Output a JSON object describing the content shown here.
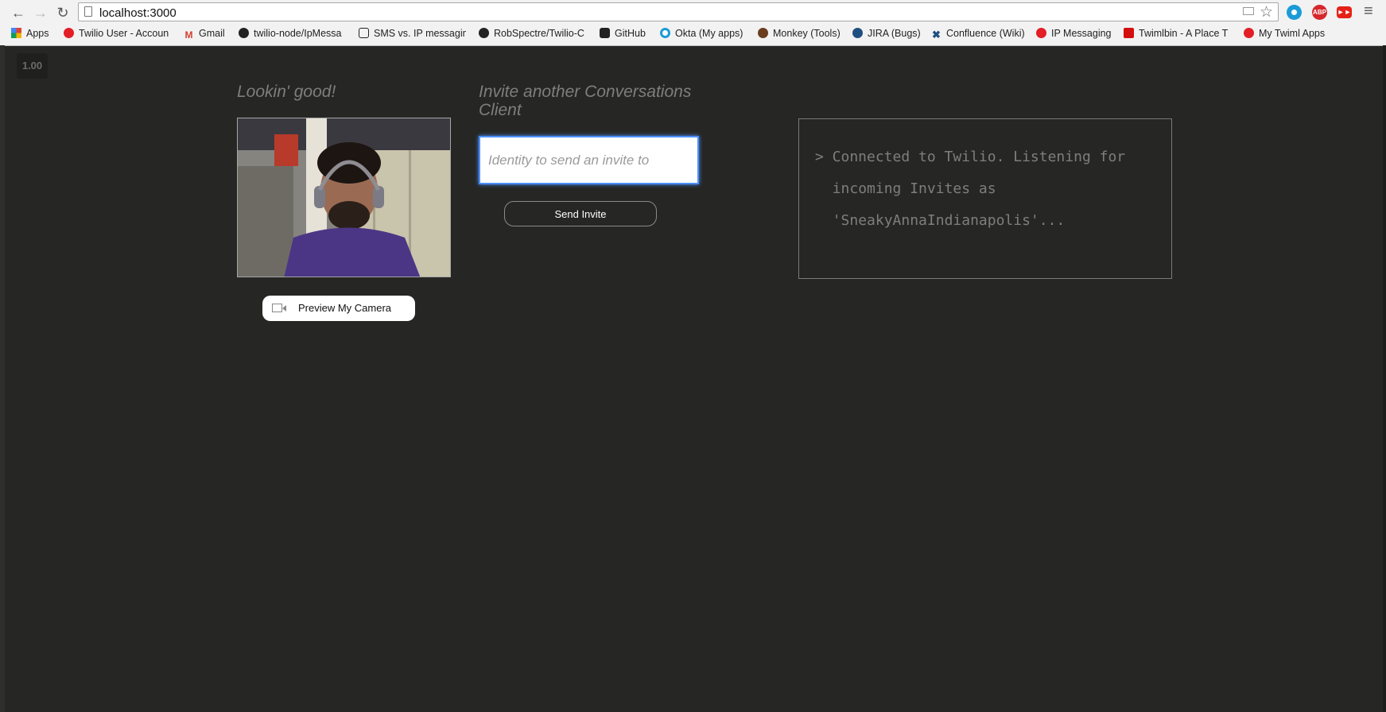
{
  "browser": {
    "url": "localhost:3000",
    "extensions": [
      "ABP"
    ],
    "bookmarks": [
      {
        "label": "Apps",
        "icon": "apps-grid-icon"
      },
      {
        "label": "Twilio User - Accoun",
        "icon": "twilio-icon"
      },
      {
        "label": "Gmail",
        "icon": "gmail-icon"
      },
      {
        "label": "twilio-node/IpMessa",
        "icon": "github-icon"
      },
      {
        "label": "SMS vs. IP messagin",
        "icon": "page-icon"
      },
      {
        "label": "RobSpectre/Twilio-C",
        "icon": "github-icon"
      },
      {
        "label": "GitHub",
        "icon": "github-icon"
      },
      {
        "label": "Okta (My apps)",
        "icon": "okta-icon"
      },
      {
        "label": "Monkey (Tools)",
        "icon": "monkey-icon"
      },
      {
        "label": "JIRA (Bugs)",
        "icon": "jira-icon"
      },
      {
        "label": "Confluence (Wiki)",
        "icon": "confluence-icon"
      },
      {
        "label": "IP Messaging",
        "icon": "twilio-icon"
      },
      {
        "label": "Twimlbin - A Place T",
        "icon": "twimlbin-icon"
      },
      {
        "label": "My Twiml Apps",
        "icon": "twilio-icon"
      }
    ]
  },
  "page": {
    "zoom_badge": "1.00",
    "local_heading": "Lookin' good!",
    "preview_button": "Preview My Camera",
    "invite_heading": "Invite another Conversations Client",
    "invite_placeholder": "Identity to send an invite to",
    "send_button": "Send Invite",
    "log": "> Connected to Twilio. Listening for\n  incoming Invites as\n  'SneakyAnnaIndianapolis'..."
  },
  "colors": {
    "background": "#262624",
    "accent_focus": "#4d90fe",
    "muted_text": "#7e7e7e"
  }
}
